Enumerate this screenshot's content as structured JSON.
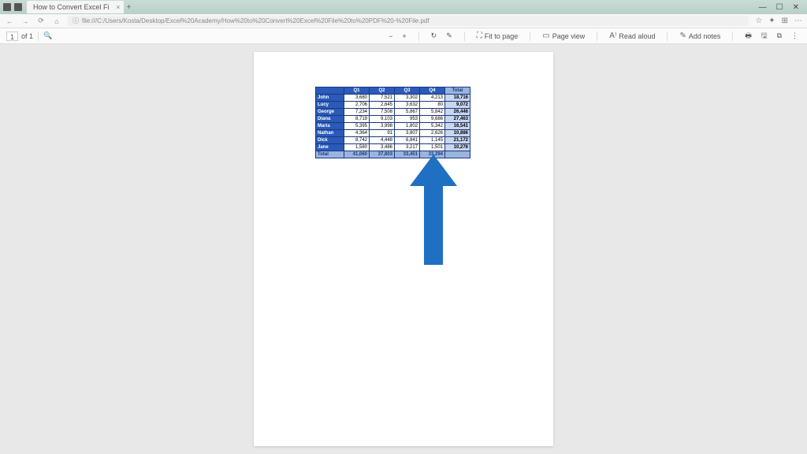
{
  "titlebar": {
    "tab_title": "How to Convert Excel Fi",
    "plus": "+",
    "win_min": "—",
    "win_max": "☐",
    "win_close": "✕"
  },
  "addressbar": {
    "back": "←",
    "forward": "→",
    "reload": "⟳",
    "home": "⌂",
    "url_prefix": "ⓘ",
    "url": "file:///C:/Users/Kosta/Desktop/Excel%20Academy/How%20to%20Convert%20Excel%20File%20to%20PDF%20-%20File.pdf",
    "star": "☆",
    "fav": "✦",
    "ext": "⊞",
    "menu": "⋯"
  },
  "toolbar": {
    "page_current": "1",
    "page_of": "of 1",
    "find": "🔍",
    "zoom_out": "−",
    "zoom_in": "+",
    "rotate": "↻",
    "draw": "✎",
    "fit_label": "Fit to page",
    "pageview_label": "Page view",
    "readaloud_label": "Read aloud",
    "addnotes_label": "Add notes",
    "print": "🖶",
    "save": "🖫",
    "extra": "⧉",
    "more": "⋮"
  },
  "chart_data": {
    "type": "table",
    "headers": [
      "",
      "Q1",
      "Q2",
      "Q3",
      "Q4",
      "Total"
    ],
    "rows": [
      {
        "name": "John",
        "q1": "3,680",
        "q2": "7,521",
        "q3": "3,302",
        "q4": "4,213",
        "total": "18,716"
      },
      {
        "name": "Lucy",
        "q1": "2,706",
        "q2": "2,645",
        "q3": "3,632",
        "q4": "80",
        "total": "9,072"
      },
      {
        "name": "George",
        "q1": "7,234",
        "q2": "7,508",
        "q3": "5,867",
        "q4": "5,842",
        "total": "26,446"
      },
      {
        "name": "Diana",
        "q1": "8,719",
        "q2": "9,103",
        "q3": "953",
        "q4": "9,686",
        "total": "27,463"
      },
      {
        "name": "Maria",
        "q1": "5,395",
        "q2": "3,998",
        "q3": "1,802",
        "q4": "5,342",
        "total": "16,541"
      },
      {
        "name": "Nathan",
        "q1": "4,364",
        "q2": "91",
        "q3": "3,807",
        "q4": "2,626",
        "total": "10,886"
      },
      {
        "name": "Dick",
        "q1": "8,742",
        "q2": "4,448",
        "q3": "6,841",
        "q4": "1,145",
        "total": "21,172"
      },
      {
        "name": "Jane",
        "q1": "1,580",
        "q2": "3,486",
        "q3": "3,217",
        "q4": "1,501",
        "total": "10,276"
      }
    ],
    "totals": {
      "name": "Total",
      "q1": "41,060",
      "q2": "37,803",
      "q3": "33,451",
      "q4": "33,294",
      "total": ""
    }
  }
}
